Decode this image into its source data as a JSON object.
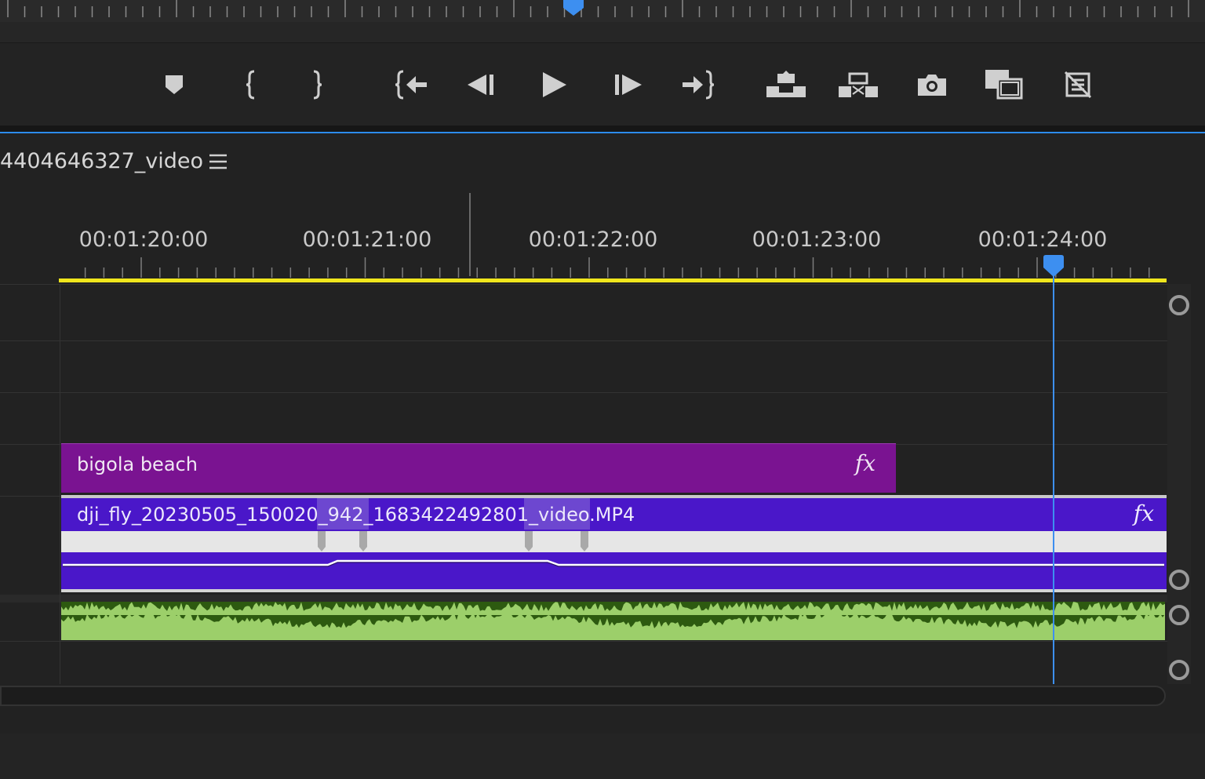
{
  "sequence": {
    "tab_title": "4404646327_video",
    "menu_icon": "hamburger-menu-icon"
  },
  "transport": {
    "buttons": [
      {
        "name": "add-marker-button",
        "icon": "marker-icon"
      },
      {
        "name": "mark-in-button",
        "icon": "mark-in-icon"
      },
      {
        "name": "mark-out-button",
        "icon": "mark-out-icon"
      },
      {
        "name": "go-to-in-button",
        "icon": "go-to-in-icon"
      },
      {
        "name": "step-back-button",
        "icon": "step-back-icon"
      },
      {
        "name": "play-button",
        "icon": "play-icon"
      },
      {
        "name": "step-forward-button",
        "icon": "step-forward-icon"
      },
      {
        "name": "go-to-out-button",
        "icon": "go-to-out-icon"
      },
      {
        "name": "lift-button",
        "icon": "lift-icon"
      },
      {
        "name": "extract-button",
        "icon": "extract-icon"
      },
      {
        "name": "export-frame-button",
        "icon": "camera-icon"
      },
      {
        "name": "comparison-view-button",
        "icon": "comparison-view-icon"
      },
      {
        "name": "toggle-proxies-button",
        "icon": "proxy-toggle-icon"
      }
    ]
  },
  "ruler": {
    "timecodes": [
      "00:01:20:00",
      "00:01:21:00",
      "00:01:22:00",
      "00:01:23:00",
      "00:01:24:00"
    ]
  },
  "clips": {
    "title_clip": {
      "label": "bigola beach",
      "fx": "fx",
      "color": "#7a1391"
    },
    "video_clip": {
      "label": "dji_fly_20230505_150020_942_1683422492801_video.MP4",
      "fx": "fx",
      "color": "#4a17c9"
    },
    "audio_clip": {
      "color": "#2d5a10",
      "waveform_color": "#9ccf6a"
    }
  },
  "colors": {
    "accent": "#2d8ceb",
    "work_area": "#f0e61c",
    "playhead": "#3d8ff0"
  }
}
